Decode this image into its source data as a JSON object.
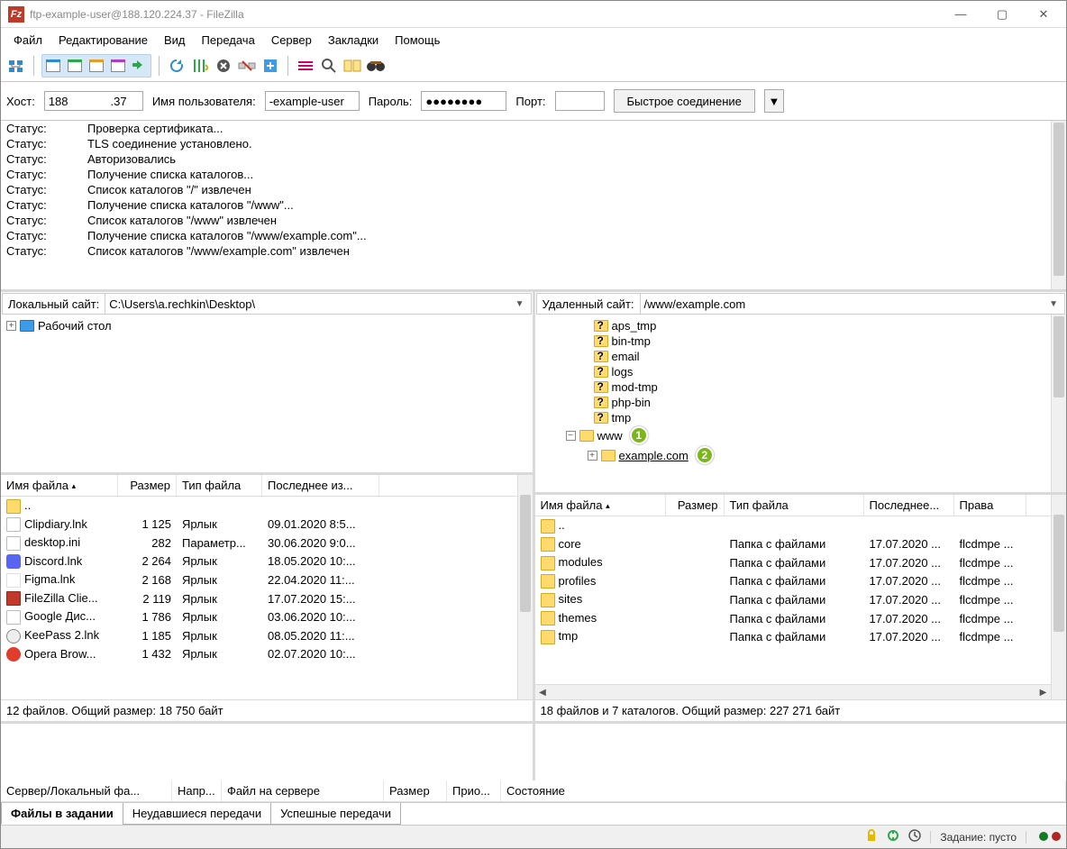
{
  "title": "ftp-example-user@188.120.224.37 - FileZilla",
  "menu": [
    "Файл",
    "Редактирование",
    "Вид",
    "Передача",
    "Сервер",
    "Закладки",
    "Помощь"
  ],
  "quickconnect": {
    "host_label": "Хост:",
    "host_value": "188             .37",
    "user_label": "Имя пользователя:",
    "user_value": "-example-user",
    "pass_label": "Пароль:",
    "pass_value": "●●●●●●●●",
    "port_label": "Порт:",
    "port_value": "",
    "button": "Быстрое соединение"
  },
  "log": [
    {
      "label": "Статус:",
      "text": "Проверка сертификата..."
    },
    {
      "label": "Статус:",
      "text": "TLS соединение установлено."
    },
    {
      "label": "Статус:",
      "text": "Авторизовались"
    },
    {
      "label": "Статус:",
      "text": "Получение списка каталогов..."
    },
    {
      "label": "Статус:",
      "text": "Список каталогов \"/\" извлечен"
    },
    {
      "label": "Статус:",
      "text": "Получение списка каталогов \"/www\"..."
    },
    {
      "label": "Статус:",
      "text": "Список каталогов \"/www\" извлечен"
    },
    {
      "label": "Статус:",
      "text": "Получение списка каталогов \"/www/example.com\"..."
    },
    {
      "label": "Статус:",
      "text": "Список каталогов \"/www/example.com\" извлечен"
    }
  ],
  "local": {
    "site_label": "Локальный сайт:",
    "path": "C:\\Users\\a.rechkin\\Desktop\\",
    "tree": [
      {
        "name": "Рабочий стол"
      }
    ],
    "columns": {
      "name": "Имя файла",
      "size": "Размер",
      "type": "Тип файла",
      "date": "Последнее из..."
    },
    "up": "..",
    "files": [
      {
        "name": "Clipdiary.lnk",
        "size": "1 125",
        "type": "Ярлык",
        "date": "09.01.2020 8:5...",
        "ic": "doc"
      },
      {
        "name": "desktop.ini",
        "size": "282",
        "type": "Параметр...",
        "date": "30.06.2020 9:0...",
        "ic": "doc"
      },
      {
        "name": "Discord.lnk",
        "size": "2 264",
        "type": "Ярлык",
        "date": "18.05.2020 10:...",
        "ic": "discord"
      },
      {
        "name": "Figma.lnk",
        "size": "2 168",
        "type": "Ярлык",
        "date": "22.04.2020 11:...",
        "ic": "figma"
      },
      {
        "name": "FileZilla Clie...",
        "size": "2 119",
        "type": "Ярлык",
        "date": "17.07.2020 15:...",
        "ic": "fz"
      },
      {
        "name": "Google Дис...",
        "size": "1 786",
        "type": "Ярлык",
        "date": "03.06.2020 10:...",
        "ic": "doc"
      },
      {
        "name": "KeePass 2.lnk",
        "size": "1 185",
        "type": "Ярлык",
        "date": "08.05.2020 11:...",
        "ic": "keepass"
      },
      {
        "name": "Opera Brow...",
        "size": "1 432",
        "type": "Ярлык",
        "date": "02.07.2020 10:...",
        "ic": "opera"
      }
    ],
    "footer": "12 файлов. Общий размер: 18 750 байт"
  },
  "remote": {
    "site_label": "Удаленный сайт:",
    "path": "/www/example.com",
    "tree": [
      {
        "name": "aps_tmp",
        "q": true,
        "indent": 48
      },
      {
        "name": "bin-tmp",
        "q": true,
        "indent": 48
      },
      {
        "name": "email",
        "q": true,
        "indent": 48
      },
      {
        "name": "logs",
        "q": true,
        "indent": 48
      },
      {
        "name": "mod-tmp",
        "q": true,
        "indent": 48
      },
      {
        "name": "php-bin",
        "q": true,
        "indent": 48
      },
      {
        "name": "tmp",
        "q": true,
        "indent": 48
      },
      {
        "name": "www",
        "q": false,
        "indent": 32,
        "expander": "−",
        "badge": "1"
      },
      {
        "name": "example.com",
        "q": false,
        "indent": 56,
        "expander": "+",
        "badge": "2",
        "sel": true
      }
    ],
    "columns": {
      "name": "Имя файла",
      "size": "Размер",
      "type": "Тип файла",
      "date": "Последнее...",
      "perm": "Права"
    },
    "up": "..",
    "files": [
      {
        "name": "core",
        "type": "Папка с файлами",
        "date": "17.07.2020 ...",
        "perm": "flcdmpe ..."
      },
      {
        "name": "modules",
        "type": "Папка с файлами",
        "date": "17.07.2020 ...",
        "perm": "flcdmpe ..."
      },
      {
        "name": "profiles",
        "type": "Папка с файлами",
        "date": "17.07.2020 ...",
        "perm": "flcdmpe ..."
      },
      {
        "name": "sites",
        "type": "Папка с файлами",
        "date": "17.07.2020 ...",
        "perm": "flcdmpe ..."
      },
      {
        "name": "themes",
        "type": "Папка с файлами",
        "date": "17.07.2020 ...",
        "perm": "flcdmpe ..."
      },
      {
        "name": "tmp",
        "type": "Папка с файлами",
        "date": "17.07.2020 ...",
        "perm": "flcdmpe ..."
      }
    ],
    "footer": "18 файлов и 7 каталогов. Общий размер: 227 271 байт"
  },
  "queue": {
    "columns": [
      "Сервер/Локальный фа...",
      "Напр...",
      "Файл на сервере",
      "Размер",
      "Прио...",
      "Состояние"
    ],
    "tabs": [
      "Файлы в задании",
      "Неудавшиеся передачи",
      "Успешные передачи"
    ]
  },
  "statusbar": {
    "queue_label": "Задание: пусто"
  }
}
